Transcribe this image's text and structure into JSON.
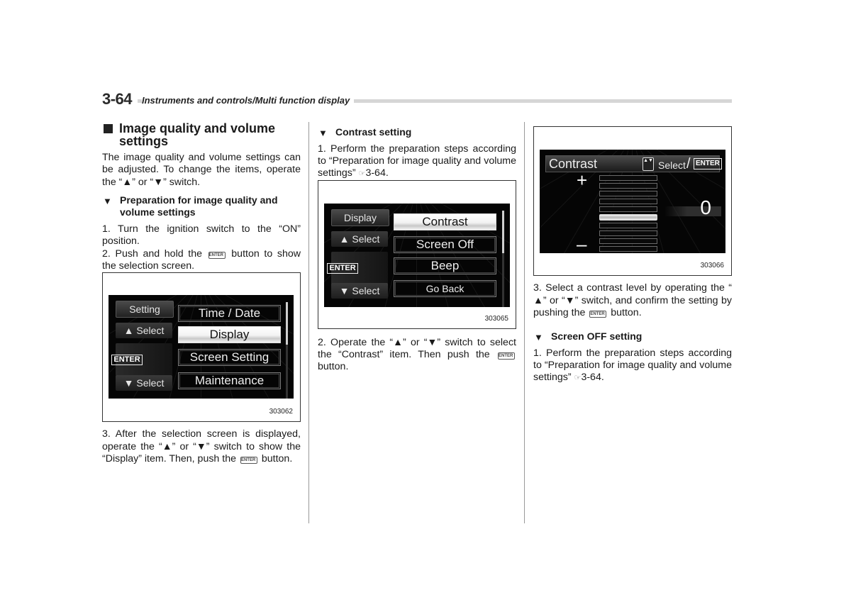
{
  "header": {
    "page_number": "3-64",
    "section": "Instruments and controls/Multi function display"
  },
  "column1": {
    "heading": "Image quality and volume settings",
    "intro": [
      "The image quality and volume settings can be adjusted. To change the items, operate the “",
      "” or “",
      "” switch."
    ],
    "subheading": "Preparation for image quality and volume settings",
    "step1": "1.  Turn the ignition switch to the “ON” position.",
    "step2": [
      "2.  Push and hold the ",
      " button to show the selection screen."
    ],
    "step3": [
      "3.  After the selection screen is displayed, operate the “",
      "” or “",
      "” switch to show the “Display” item. Then, push the ",
      " button."
    ]
  },
  "column2": {
    "subheading": "Contrast setting",
    "step1": [
      "1.  Perform the preparation steps according to “Preparation for image quality and volume settings” ",
      "3-64."
    ],
    "step2": [
      "2.  Operate the “",
      "” or “",
      "” switch to select the “Contrast” item. Then push the ",
      " button."
    ]
  },
  "column3": {
    "step3": [
      "3.  Select a contrast level by operating the “",
      "” or “",
      "” switch, and confirm the setting by pushing the ",
      " button."
    ],
    "subheading": "Screen OFF setting",
    "step1": [
      "1.  Perform the preparation steps according to “Preparation for image quality and volume settings” ",
      "3-64."
    ]
  },
  "icons": {
    "up": "▲",
    "down": "▼",
    "square": "■",
    "ref": "☞",
    "enter_small": "ENTER"
  },
  "figures": {
    "fig1": {
      "code": "303062",
      "left_title": "Setting",
      "up_label": "▲ Select",
      "enter_label": "ENTER",
      "down_label": "▼ Select",
      "items": [
        {
          "label": "Time / Date",
          "selected": false
        },
        {
          "label": "Display",
          "selected": true
        },
        {
          "label": "Screen Setting",
          "selected": false
        },
        {
          "label": "Maintenance",
          "selected": false
        }
      ]
    },
    "fig2": {
      "code": "303065",
      "left_title": "Display",
      "up_label": "▲ Select",
      "enter_label": "ENTER",
      "down_label": "▼ Select",
      "items": [
        {
          "label": "Contrast",
          "selected": true
        },
        {
          "label": "Screen Off",
          "selected": false
        },
        {
          "label": "Beep",
          "selected": false
        },
        {
          "label": "Go Back",
          "selected": false
        }
      ]
    },
    "fig3": {
      "code": "303066",
      "title": "Contrast",
      "updown_icon": "▲▼",
      "select_label": "Select",
      "slash": "/",
      "enter_label": "ENTER",
      "plus": "+",
      "minus": "–",
      "value": "0",
      "levels_above": 5,
      "levels_below": 5
    }
  }
}
